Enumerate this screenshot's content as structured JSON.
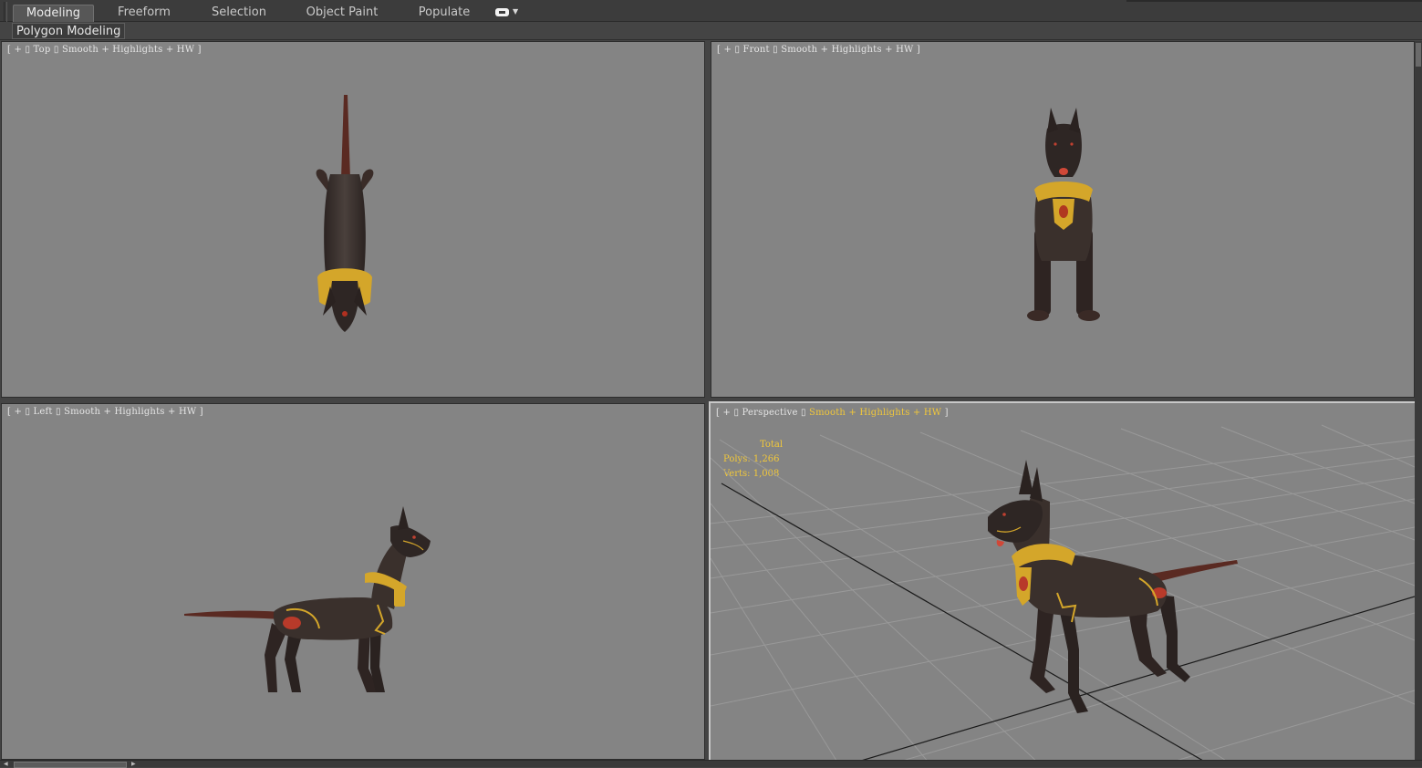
{
  "ribbon": {
    "tabs": [
      {
        "label": "Modeling",
        "active": true
      },
      {
        "label": "Freeform",
        "active": false
      },
      {
        "label": "Selection",
        "active": false
      },
      {
        "label": "Object Paint",
        "active": false
      },
      {
        "label": "Populate",
        "active": false
      }
    ],
    "panel_label": "Polygon Modeling"
  },
  "viewports": {
    "top": {
      "plus": "+",
      "name": "Top",
      "shading": "Smooth + Highlights + HW"
    },
    "front": {
      "plus": "+",
      "name": "Front",
      "shading": "Smooth + Highlights + HW"
    },
    "left": {
      "plus": "+",
      "name": "Left",
      "shading": "Smooth + Highlights + HW"
    },
    "perspective": {
      "plus": "+",
      "name": "Perspective",
      "shading": "Smooth + Highlights + HW",
      "active": true
    }
  },
  "stats": {
    "title": "Total",
    "polys": "Polys: 1,266",
    "verts": "Verts: 1,008"
  },
  "colors": {
    "viewport_bg": "#848484",
    "label_text": "#e4e4e4",
    "highlight_yellow": "#f2c83a",
    "dog_body": "#3a302c",
    "gold": "#d4a62a"
  },
  "icons": {
    "ribbon_toggle": "ribbon-minimize-icon"
  }
}
